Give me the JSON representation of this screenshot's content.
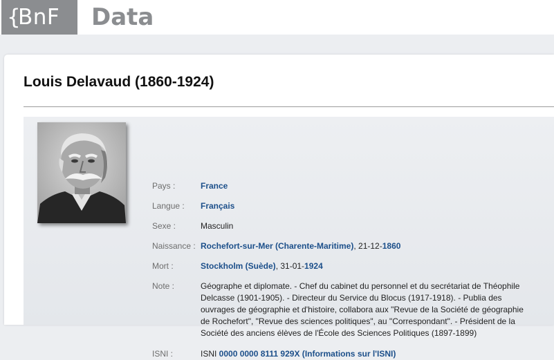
{
  "header": {
    "logo_brace": "{",
    "logo_text": "BnF",
    "section_title": "Data"
  },
  "person": {
    "name": "Louis Delavaud (1860-1924)"
  },
  "fields": {
    "pays": {
      "label": "Pays :",
      "value": "France"
    },
    "langue": {
      "label": "Langue :",
      "value": "Français"
    },
    "sexe": {
      "label": "Sexe :",
      "value": "Masculin"
    },
    "naissance": {
      "label": "Naissance :",
      "place": "Rochefort-sur-Mer (Charente-Maritime)",
      "sep": ", ",
      "daymonth": "21-12-",
      "year": "1860"
    },
    "mort": {
      "label": "Mort :",
      "place": "Stockholm (Suède)",
      "sep": ", ",
      "daymonth": "31-01-",
      "year": "1924"
    },
    "note": {
      "label": "Note :",
      "value": "Géographe et diplomate. - Chef du cabinet du personnel et du secrétariat de Théophile Delcasse (1901-1905). - Directeur du Service du Blocus (1917-1918). - Publia des ouvrages de géographie et d'histoire, collabora aux \"Revue de la Société de géographie de Rochefort\", \"Revue des sciences politiques\", au \"Correspondant\". - Président de la Société des anciens élèves de l'École des Sciences Politiques (1897-1899)"
    },
    "isni": {
      "label": "ISNI :",
      "prefix": "ISNI ",
      "number": "0000 0000 8111 929X",
      "open": " (",
      "info_link": "Informations sur l'ISNI",
      "close": ")"
    }
  },
  "colors": {
    "link": "#1c4f8a",
    "logo_gray": "#8b8d90",
    "label_gray": "#6d6d6d"
  }
}
